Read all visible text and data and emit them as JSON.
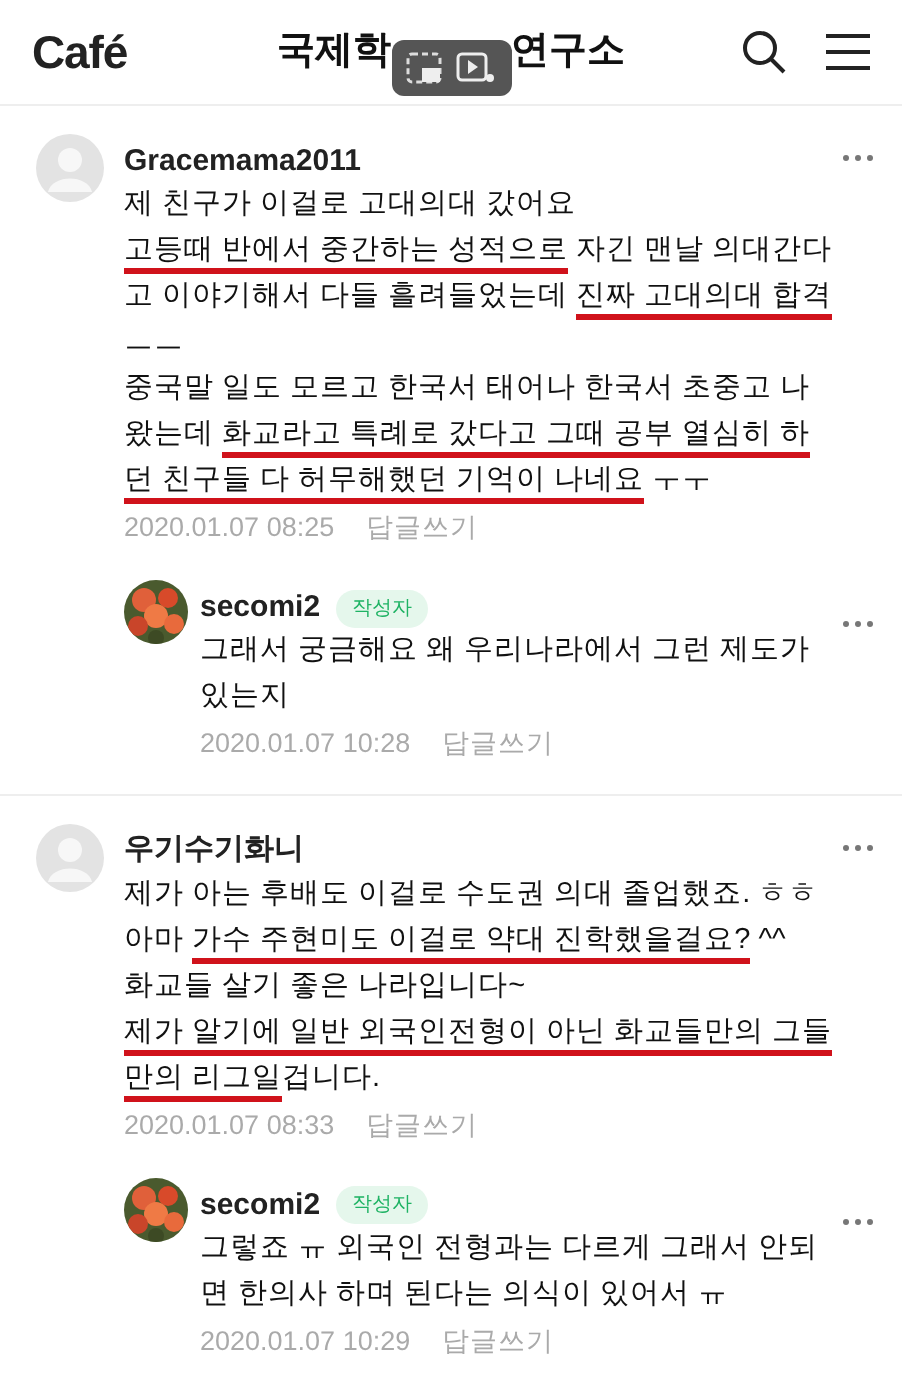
{
  "header": {
    "logo": "Café",
    "title_parts": [
      "국제학",
      "연구소"
    ]
  },
  "comments": [
    {
      "kind": "comment",
      "author": "Gracemama2011",
      "lines": [
        [
          {
            "text": "제 친구가 이걸로 고대의대 갔어요",
            "underlined": false
          }
        ],
        [
          {
            "text": "고등때 반에서 중간하는 성적으로",
            "underlined": true
          },
          {
            "text": " 자긴 맨날 의대간다",
            "underlined": false
          }
        ],
        [
          {
            "text": "고 이야기해서 다들 흘려들었는데 ",
            "underlined": false
          },
          {
            "text": "진짜 고대의대 합격",
            "underlined": true
          }
        ],
        [
          {
            "text": "ㅡㅡ",
            "underlined": false
          }
        ],
        [
          {
            "text": "중국말 일도 모르고 한국서 태어나 한국서 초중고 나",
            "underlined": false
          }
        ],
        [
          {
            "text": "왔는데 ",
            "underlined": false
          },
          {
            "text": "화교라고 특례로 갔다고 그때 공부 열심히 하",
            "underlined": true
          }
        ],
        [
          {
            "text": "던 친구들 다 허무해했던 기억이 나네요",
            "underlined": true
          },
          {
            "text": " ㅜㅜ",
            "underlined": false
          }
        ]
      ],
      "date": "2020.01.07 08:25",
      "reply_link": "답글쓰기"
    },
    {
      "kind": "reply",
      "author": "secomi2",
      "badge": "작성자",
      "lines": [
        [
          {
            "text": "그래서 궁금해요 왜 우리나라에서 그런 제도가",
            "underlined": false
          }
        ],
        [
          {
            "text": "있는지",
            "underlined": false
          }
        ]
      ],
      "date": "2020.01.07 10:28",
      "reply_link": "답글쓰기"
    },
    {
      "kind": "comment",
      "author": "우기수기화니",
      "lines": [
        [
          {
            "text": "제가 아는 후배도 이걸로 수도권 의대 졸업했죠. ㅎㅎ",
            "underlined": false
          }
        ],
        [
          {
            "text": "아마 ",
            "underlined": false
          },
          {
            "text": "가수 주현미도 이걸로 약대 진학했을걸요?",
            "underlined": true
          },
          {
            "text": " ^^",
            "underlined": false
          }
        ],
        [
          {
            "text": "화교들 살기 좋은 나라입니다~",
            "underlined": false
          }
        ],
        [
          {
            "text": "제가 알기에 일반 외국인전형이 아닌 화교들만의 그들",
            "underlined": true
          }
        ],
        [
          {
            "text": "만의 리그일",
            "underlined": true
          },
          {
            "text": "겁니다.",
            "underlined": false
          }
        ]
      ],
      "date": "2020.01.07 08:33",
      "reply_link": "답글쓰기"
    },
    {
      "kind": "reply",
      "author": "secomi2",
      "badge": "작성자",
      "lines": [
        [
          {
            "text": "그렇죠 ㅠ 외국인 전형과는 다르게 그래서 안되",
            "underlined": false
          }
        ],
        [
          {
            "text": "면 한의사 하며 된다는 의식이 있어서 ㅠ",
            "underlined": false
          }
        ]
      ],
      "date": "2020.01.07 10:29",
      "reply_link": "답글쓰기"
    }
  ]
}
